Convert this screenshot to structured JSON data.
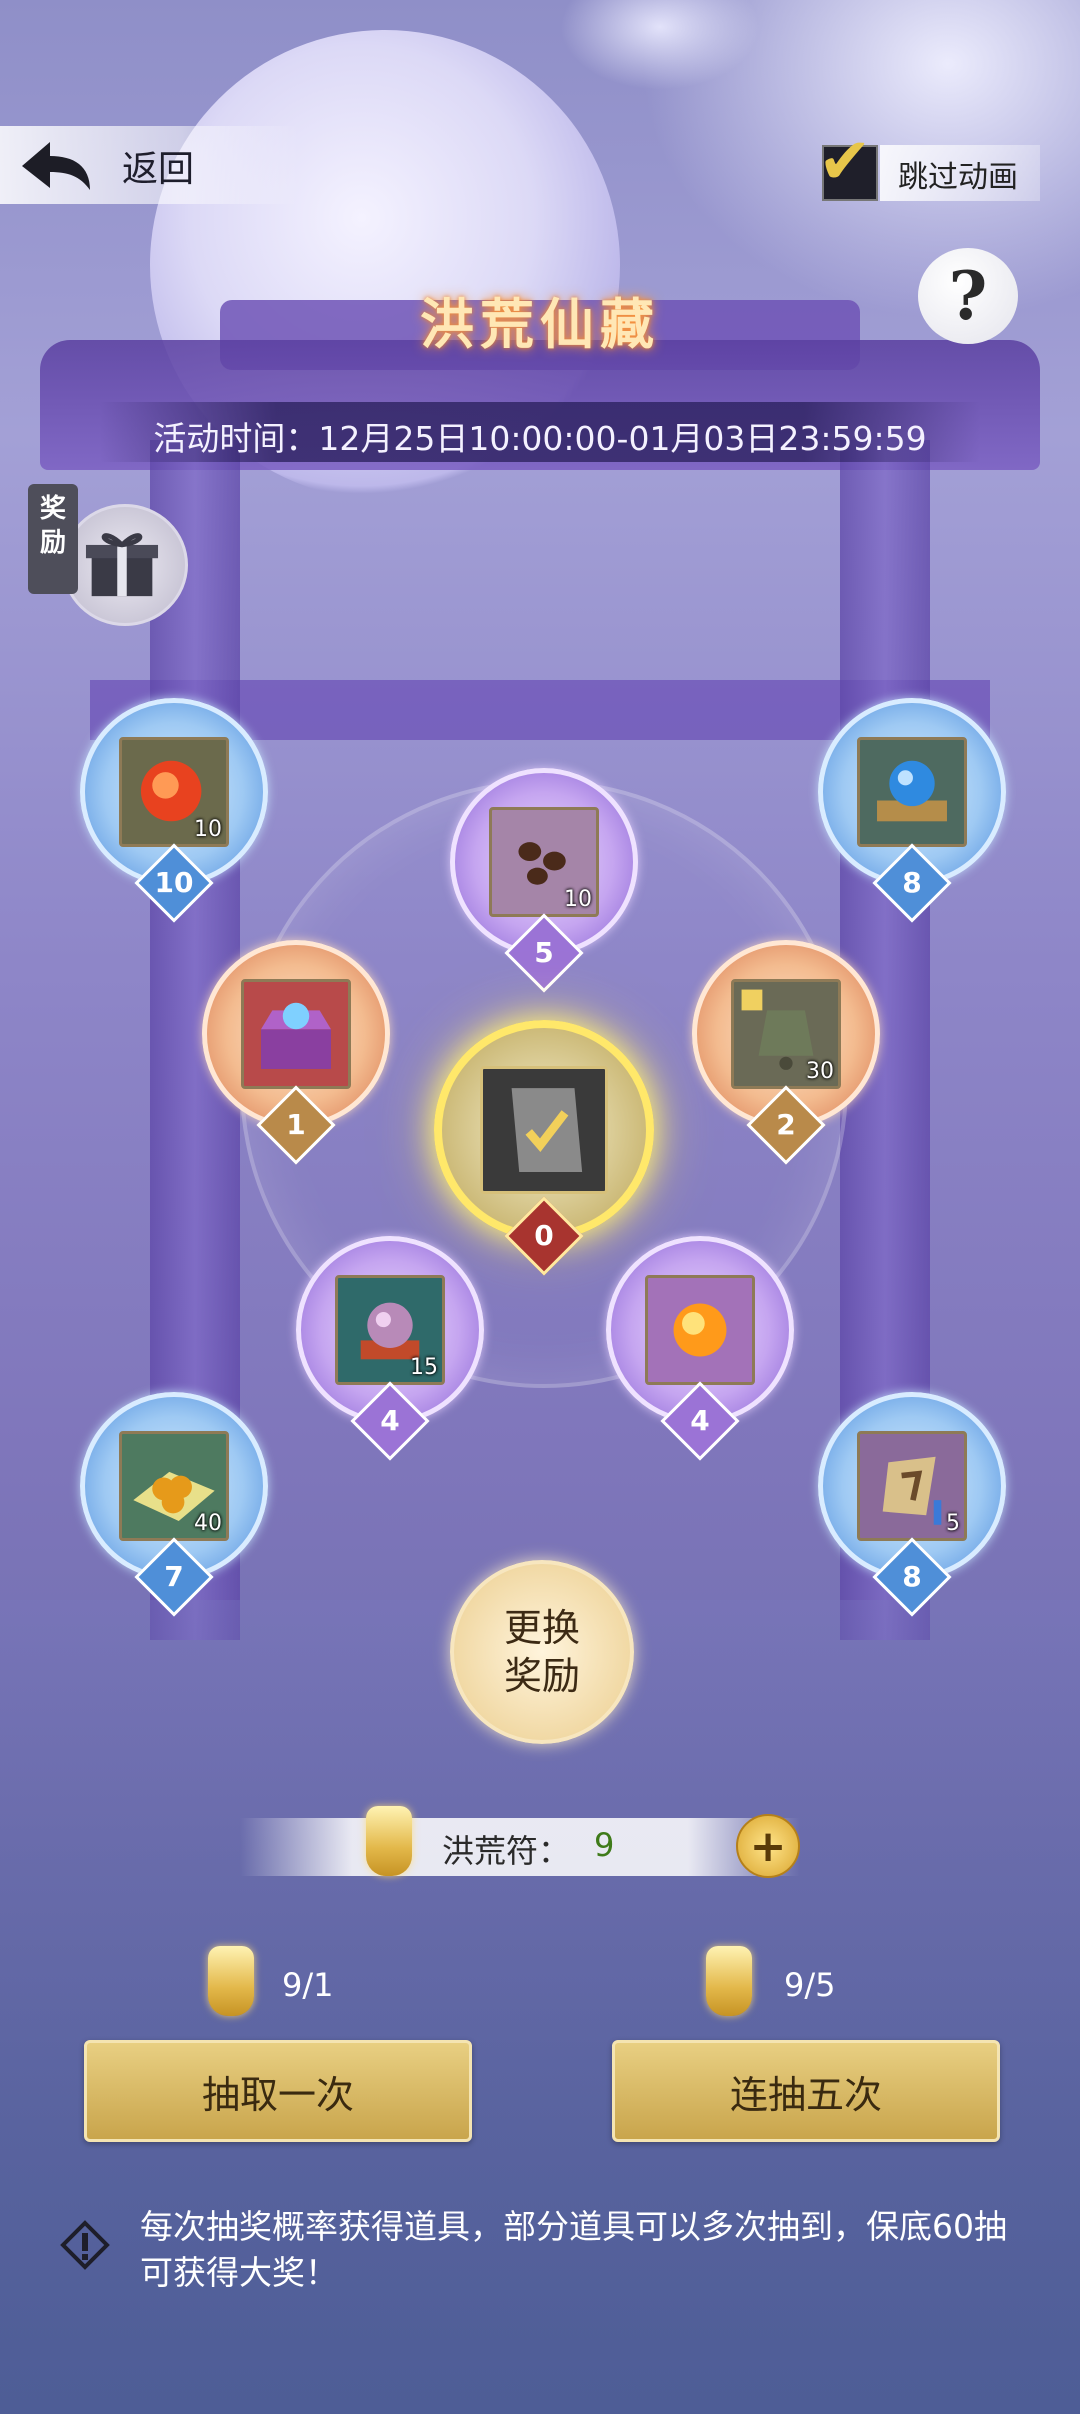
{
  "header": {
    "back_label": "返回",
    "skip_label": "跳过动画",
    "skip_checked": true,
    "help_label": "?"
  },
  "banner": {
    "title": "洪荒仙藏",
    "activity_time": "活动时间：12月25日10:00:00-01月03日23:59:59"
  },
  "reward_tag": "奖励",
  "prizes": [
    {
      "id": "red-gem",
      "qty": "10",
      "badge": "10",
      "tier": "blue",
      "icon": "red-gem-icon"
    },
    {
      "id": "seeds",
      "qty": "10",
      "badge": "5",
      "tier": "purple",
      "icon": "seeds-icon"
    },
    {
      "id": "blue-orb",
      "qty": "",
      "badge": "8",
      "tier": "blue",
      "icon": "blue-orb-icon"
    },
    {
      "id": "treasure-chest",
      "qty": "",
      "badge": "1",
      "tier": "orange",
      "icon": "treasure-chest-icon"
    },
    {
      "id": "bell-fragment",
      "qty": "30",
      "badge": "2",
      "tier": "orange",
      "icon": "bell-fragment-icon"
    },
    {
      "id": "grand-prize-card",
      "qty": "",
      "badge": "0",
      "tier": "center",
      "icon": "grand-prize-card-icon"
    },
    {
      "id": "pink-orb",
      "qty": "15",
      "badge": "4",
      "tier": "purple",
      "icon": "pink-orb-icon"
    },
    {
      "id": "fire-orb",
      "qty": "",
      "badge": "4",
      "tier": "purple",
      "icon": "fire-orb-icon"
    },
    {
      "id": "golden-pills",
      "qty": "40",
      "badge": "7",
      "tier": "blue",
      "icon": "golden-pills-icon"
    },
    {
      "id": "jade-pendant",
      "qty": "5",
      "badge": "8",
      "tier": "blue",
      "icon": "jade-pendant-icon"
    }
  ],
  "change_rewards_label": "更换\n奖励",
  "currency": {
    "label": "洪荒符：",
    "value": "9",
    "icon": "talisman-icon"
  },
  "draws": {
    "single": {
      "cost": "9/1",
      "label": "抽取一次"
    },
    "five": {
      "cost": "9/5",
      "label": "连抽五次"
    }
  },
  "notice": "每次抽奖概率获得道具，部分道具可以多次抽到，保底60抽可获得大奖！",
  "colors": {
    "gold": "#e3b84a",
    "accent_green": "#3f7b1a"
  }
}
